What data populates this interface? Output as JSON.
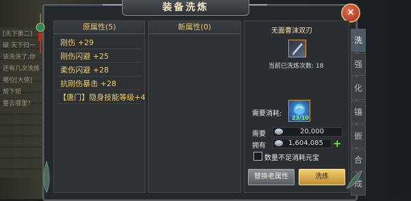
{
  "window": {
    "title": "装备洗炼"
  },
  "background_text": [
    "[天下第二]",
    "破·天下归一",
    "该洗洗了,你",
    "还有几次洗炼",
    "哪位[大侠]",
    "帮下呗",
    "要去哪里?"
  ],
  "original_attrs": {
    "header": "原属性(5)",
    "items": [
      "刚伤 +29",
      "刚伤闪避 +25",
      "柔伤闪避 +28",
      "抗刚伤暴击 +28",
      "【唐门】隐身技能等级+4"
    ]
  },
  "new_attrs": {
    "header": "新属性(0)"
  },
  "item": {
    "name": "无面曹沫双刃",
    "wash_count_label": "当前已洗炼次数: 18"
  },
  "consume": {
    "label": "需要消耗:",
    "material_qty": "23/10",
    "need_label": "需要",
    "need_value": "20,000",
    "have_label": "拥有",
    "have_value": "1,604,085",
    "plus_symbol": "+"
  },
  "option": {
    "label": "数量不足消耗元宝",
    "checked": false
  },
  "buttons": {
    "replace": "替换老属性",
    "wash": "洗炼",
    "close": "×"
  },
  "side_tabs": [
    "洗",
    "强",
    "化",
    "镶",
    "嵌",
    "合",
    "成"
  ],
  "colors": {
    "attr_text": "#f0d060",
    "header_text": "#e8c77a",
    "gold_button": "#e0b050",
    "plus_green": "#70e040"
  }
}
